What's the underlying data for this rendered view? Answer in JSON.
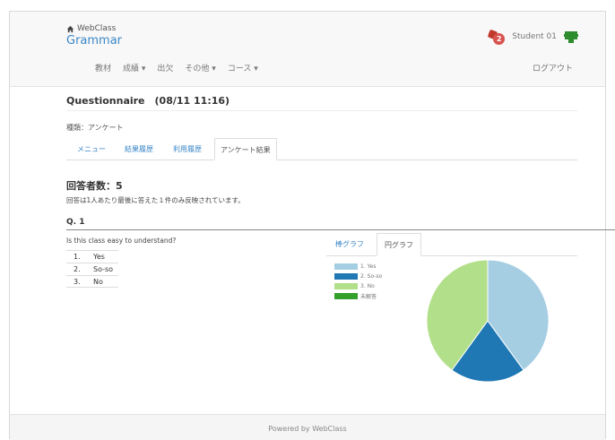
{
  "header": {
    "brand_small": "WebClass",
    "course_title": "Grammar",
    "notification_count": "2",
    "user_name": "Student 01",
    "nav": [
      {
        "label": "教材"
      },
      {
        "label": "成績 ▾"
      },
      {
        "label": "出欠"
      },
      {
        "label": "その他 ▾"
      },
      {
        "label": "コース ▾"
      }
    ],
    "logout_label": "ログアウト"
  },
  "main": {
    "title": "Questionnaire　(08/11 11:16)",
    "type_line": "種類：アンケート",
    "tabs": [
      {
        "label": "メニュー"
      },
      {
        "label": "結果履歴"
      },
      {
        "label": "利用履歴"
      },
      {
        "label": "アンケート結果"
      }
    ],
    "answer_count_label": "回答者数：5",
    "answer_note": "回答は1人あたり最後に答えた１件のみ反映されています。",
    "question_number": "Q. 1",
    "question_text": "Is this class easy to understand?",
    "choices": [
      {
        "num": "1.",
        "label": "Yes"
      },
      {
        "num": "2.",
        "label": "So-so"
      },
      {
        "num": "3.",
        "label": "No"
      }
    ],
    "chart_tabs": [
      {
        "label": "棒グラフ"
      },
      {
        "label": "円グラフ"
      }
    ]
  },
  "chart_data": {
    "type": "pie",
    "labels": [
      "1. Yes",
      "2. So-so",
      "3. No",
      "未解答"
    ],
    "values": [
      2,
      1,
      2,
      0
    ],
    "colors": [
      "#a6cee3",
      "#1f78b4",
      "#b2df8a",
      "#33a02c"
    ]
  },
  "footer": {
    "text": "Powered by WebClass"
  }
}
